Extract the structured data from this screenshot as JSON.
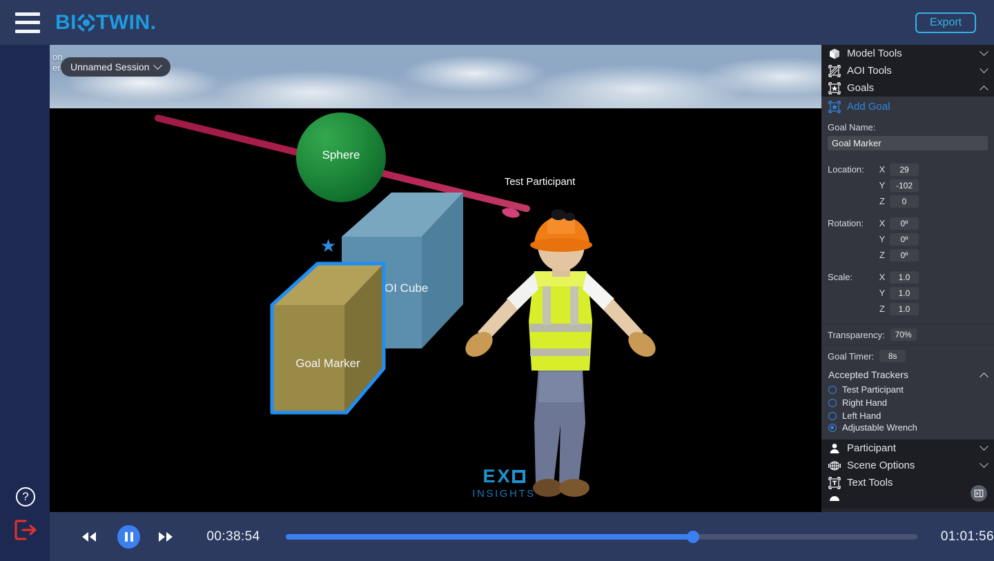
{
  "topbar": {
    "menu_icon": "hamburger-icon",
    "logo_text_before": "BI",
    "logo_text_after": "TWIN",
    "logo_period": ".",
    "export_label": "Export"
  },
  "sidebar": {
    "help_glyph": "?",
    "help_name": "help-icon",
    "logout_name": "logout-icon"
  },
  "viewport": {
    "session_label": "Unnamed Session",
    "occluded_text_line1": "on",
    "occluded_text_line2": "er",
    "objects": {
      "sphere_label": "Sphere",
      "aoi_cube_label": "AOI Cube",
      "goal_marker_label": "Goal Marker",
      "participant_label": "Test Participant"
    },
    "watermark": {
      "brand_e": "E",
      "brand_x": "X",
      "brand_sub": "INSIGHTS"
    }
  },
  "panel": {
    "sections": [
      {
        "label": "Model Tools",
        "icon": "cube-icon",
        "expanded": false
      },
      {
        "label": "AOI Tools",
        "icon": "aoi-square-icon",
        "expanded": false
      },
      {
        "label": "Goals",
        "icon": "goal-star-icon",
        "expanded": true
      }
    ],
    "add_goal_label": "Add Goal",
    "goal_name_label": "Goal Name:",
    "goal_name_value": "Goal Marker",
    "transform": [
      {
        "name": "Location:",
        "axes": [
          "X",
          "Y",
          "Z"
        ],
        "values": [
          "29",
          "-102",
          "0"
        ]
      },
      {
        "name": "Rotation:",
        "axes": [
          "X",
          "Y",
          "Z"
        ],
        "values": [
          "0º",
          "0º",
          "0º"
        ]
      },
      {
        "name": "Scale:",
        "axes": [
          "X",
          "Y",
          "Z"
        ],
        "values": [
          "1.0",
          "1.0",
          "1.0"
        ]
      }
    ],
    "transparency_label": "Transparency:",
    "transparency_value": "70%",
    "goal_timer_label": "Goal Timer:",
    "goal_timer_value": "8s",
    "trackers_label": "Accepted Trackers",
    "trackers": [
      {
        "label": "Test Participant",
        "selected": false
      },
      {
        "label": "Right Hand",
        "selected": false
      },
      {
        "label": "Left Hand",
        "selected": false
      },
      {
        "label": "Adjustable Wrench",
        "selected": true
      }
    ],
    "bottom_sections": [
      {
        "label": "Participant",
        "icon": "person-icon",
        "expanded": false
      },
      {
        "label": "Scene Options",
        "icon": "scene-grid-icon",
        "expanded": false
      },
      {
        "label": "Text Tools",
        "icon": "text-tool-icon",
        "expanded": false
      }
    ],
    "collapse_icon": "panel-collapse-icon"
  },
  "playback": {
    "rewind_icon": "rewind-icon",
    "playpause_icon": "pause-icon",
    "forward_icon": "fast-forward-icon",
    "current_time": "00:38:54",
    "total_time": "01:01:56",
    "progress_percent": 64.5
  },
  "colors": {
    "brand_blue": "#1e9ae0",
    "accent_blue": "#3b7ff0",
    "link_blue": "#2f86e8",
    "topbar_navy": "#2b3a5e",
    "sidebar_navy": "#1d2951",
    "panel_bg": "#24262d",
    "panel_row_bg": "#33363e",
    "logout_red": "#e8312a",
    "sphere_green": "#1f8b3b",
    "aoi_blue": "#5b8fad",
    "goal_tan": "#9a8a47",
    "gaze_crimson": "#b02050"
  }
}
